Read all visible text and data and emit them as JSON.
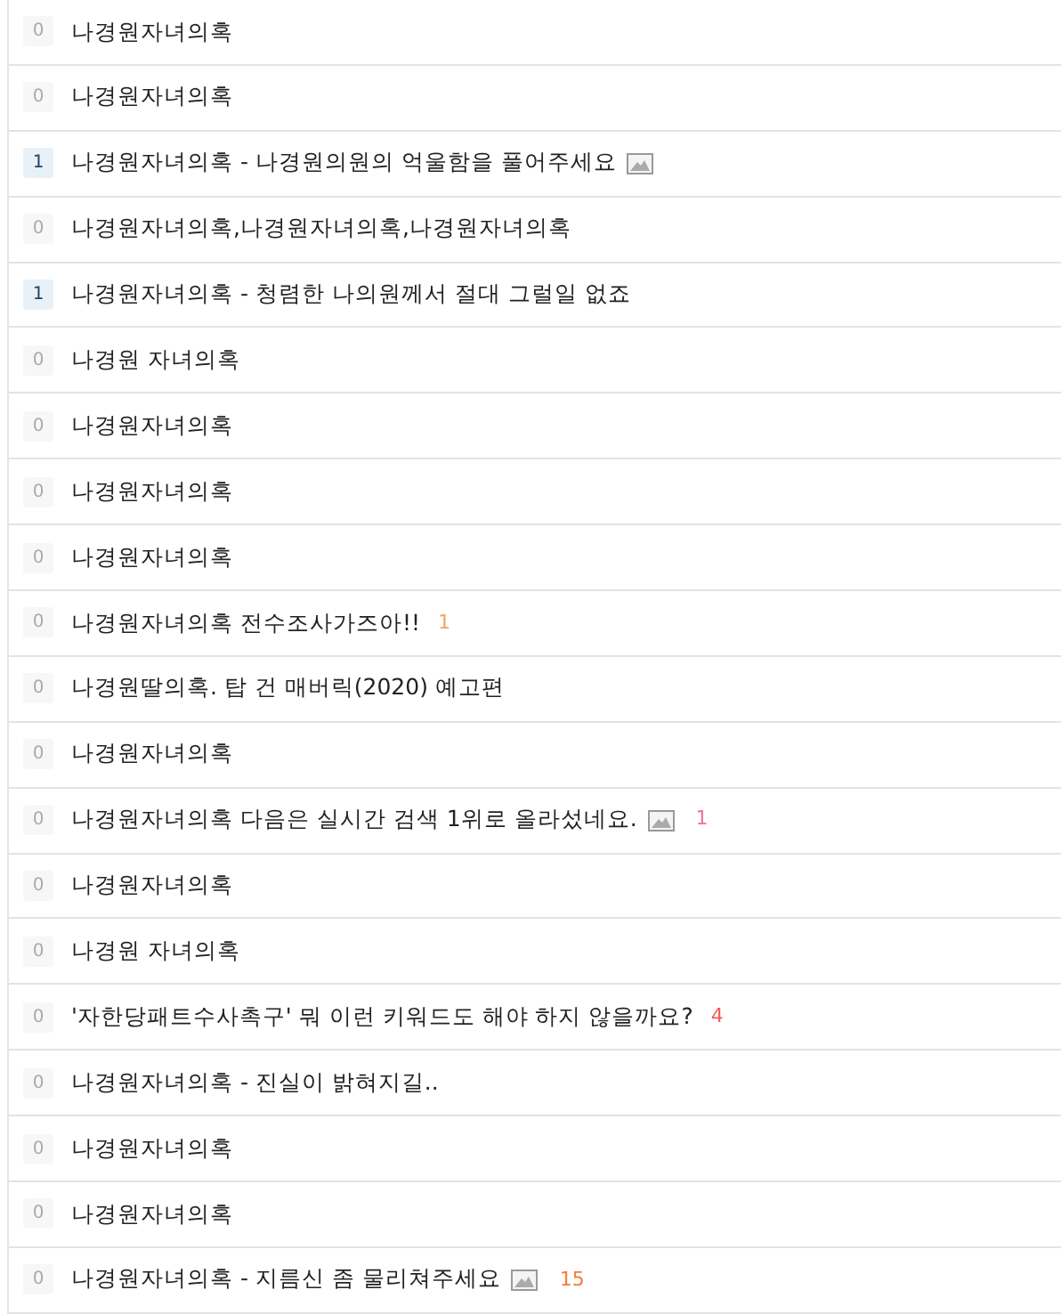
{
  "posts": [
    {
      "votes": "0",
      "votes_highlighted": false,
      "title": "나경원자녀의혹",
      "has_image": false
    },
    {
      "votes": "0",
      "votes_highlighted": false,
      "title": "나경원자녀의혹",
      "has_image": false
    },
    {
      "votes": "1",
      "votes_highlighted": true,
      "title": "나경원자녀의혹 - 나경원의원의 억울함을 풀어주세요",
      "has_image": true
    },
    {
      "votes": "0",
      "votes_highlighted": false,
      "title": "나경원자녀의혹,나경원자녀의혹,나경원자녀의혹",
      "has_image": false
    },
    {
      "votes": "1",
      "votes_highlighted": true,
      "title": "나경원자녀의혹 - 청렴한 나의원께서 절대 그럴일 없죠",
      "has_image": false
    },
    {
      "votes": "0",
      "votes_highlighted": false,
      "title": "나경원 자녀의혹",
      "has_image": false
    },
    {
      "votes": "0",
      "votes_highlighted": false,
      "title": "나경원자녀의혹",
      "has_image": false
    },
    {
      "votes": "0",
      "votes_highlighted": false,
      "title": "나경원자녀의혹",
      "has_image": false
    },
    {
      "votes": "0",
      "votes_highlighted": false,
      "title": "나경원자녀의혹",
      "has_image": false
    },
    {
      "votes": "0",
      "votes_highlighted": false,
      "title": "나경원자녀의혹 전수조사가즈아!!",
      "has_image": false,
      "comments": {
        "text": "1",
        "color": "#f4a261"
      }
    },
    {
      "votes": "0",
      "votes_highlighted": false,
      "title": "나경원딸의혹. 탑 건 매버릭(2020) 예고편",
      "has_image": false
    },
    {
      "votes": "0",
      "votes_highlighted": false,
      "title": "나경원자녀의혹",
      "has_image": false
    },
    {
      "votes": "0",
      "votes_highlighted": false,
      "title": "나경원자녀의혹 다음은 실시간 검색 1위로 올라섰네요.",
      "has_image": true,
      "comments": {
        "text": "1",
        "color": "#f0738f"
      }
    },
    {
      "votes": "0",
      "votes_highlighted": false,
      "title": "나경원자녀의혹",
      "has_image": false
    },
    {
      "votes": "0",
      "votes_highlighted": false,
      "title": "나경원 자녀의혹",
      "has_image": false
    },
    {
      "votes": "0",
      "votes_highlighted": false,
      "title": "'자한당패트수사촉구' 뭐 이런 키워드도 해야 하지 않을까요?",
      "has_image": false,
      "comments": {
        "text": "4",
        "color": "#f25c54"
      }
    },
    {
      "votes": "0",
      "votes_highlighted": false,
      "title": "나경원자녀의혹 - 진실이 밝혀지길..",
      "has_image": false
    },
    {
      "votes": "0",
      "votes_highlighted": false,
      "title": "나경원자녀의혹",
      "has_image": false
    },
    {
      "votes": "0",
      "votes_highlighted": false,
      "title": "나경원자녀의혹",
      "has_image": false
    },
    {
      "votes": "0",
      "votes_highlighted": false,
      "title": "나경원자녀의혹 - 지름신 좀 물리쳐주세요",
      "has_image": true,
      "comments": {
        "text": "15",
        "color": "#f47c3c"
      }
    }
  ]
}
